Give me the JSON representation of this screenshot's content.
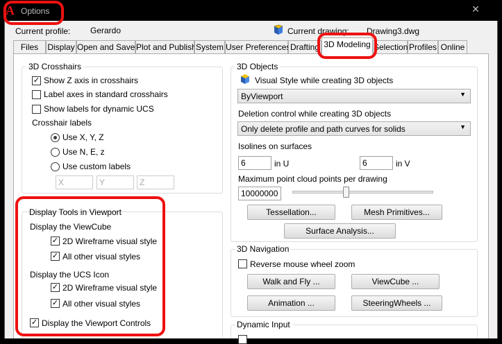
{
  "app": {
    "logo": "A",
    "title": "Options",
    "close_glyph": "✕"
  },
  "header": {
    "current_profile_label": "Current profile:",
    "current_profile_value": "Gerardo",
    "current_drawing_label": "Current drawing:",
    "current_drawing_value": "Drawing3.dwg"
  },
  "tabs": [
    {
      "label": "Files"
    },
    {
      "label": "Display"
    },
    {
      "label": "Open and Save"
    },
    {
      "label": "Plot and Publish"
    },
    {
      "label": "System"
    },
    {
      "label": "User Preferences"
    },
    {
      "label": "Drafting"
    },
    {
      "label": "3D Modeling",
      "active": true
    },
    {
      "label": "Selection"
    },
    {
      "label": "Profiles"
    },
    {
      "label": "Online"
    }
  ],
  "crosshairs": {
    "title": "3D Crosshairs",
    "show_z": {
      "label": "Show Z axis in crosshairs",
      "checked": true
    },
    "label_axes": {
      "label": "Label axes in standard crosshairs",
      "checked": false
    },
    "dyn_ucs": {
      "label": "Show labels for dynamic UCS",
      "checked": false
    },
    "labels_title": "Crosshair labels",
    "radio_xyz": "Use X, Y, Z",
    "radio_nez": "Use N, E, z",
    "radio_custom": "Use custom labels",
    "custom_x": "X",
    "custom_y": "Y",
    "custom_z": "Z"
  },
  "display_tools": {
    "title": "Display Tools in Viewport",
    "viewcube_title": "Display the ViewCube",
    "vc_wire": "2D Wireframe visual style",
    "vc_other": "All other visual styles",
    "ucs_title": "Display the UCS Icon",
    "ucs_wire": "2D Wireframe visual style",
    "ucs_other": "All other visual styles",
    "viewport_controls": "Display the Viewport Controls"
  },
  "objects3d": {
    "title": "3D Objects",
    "visual_style_label": "Visual Style while creating 3D objects",
    "visual_style_value": "ByViewport",
    "deletion_label": "Deletion control while creating 3D objects",
    "deletion_value": "Only delete profile and path curves for solids",
    "isolines_label": "Isolines on surfaces",
    "iso_u_value": "6",
    "iso_u_label": "in U",
    "iso_v_value": "6",
    "iso_v_label": "in V",
    "cloud_label": "Maximum point cloud points per drawing",
    "cloud_value": "10000000",
    "cloud_slider_fraction": 0.38,
    "tessellation_btn": "Tessellation...",
    "mesh_btn": "Mesh Primitives...",
    "surface_btn": "Surface Analysis..."
  },
  "navigation": {
    "title": "3D Navigation",
    "reverse_wheel": "Reverse mouse wheel zoom",
    "walk_btn": "Walk and Fly ...",
    "viewcube_btn": "ViewCube ...",
    "animation_btn": "Animation ...",
    "steering_btn": "SteeringWheels ..."
  },
  "dynamic_input": {
    "title": "Dynamic Input"
  },
  "check_glyph": "✓"
}
